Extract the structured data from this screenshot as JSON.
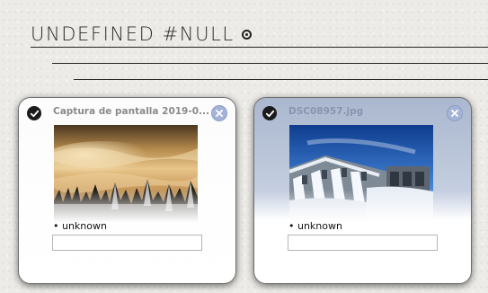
{
  "header": {
    "title": "UNDEFINED #NULL",
    "target_icon": "target-icon"
  },
  "cards": [
    {
      "filename": "Captura de pantalla 2019-0...",
      "tag": "• unknown",
      "tag_input_value": "",
      "selected": true,
      "thumbnail": "snowy-forest-sunset"
    },
    {
      "filename": "DSC08957.jpg",
      "tag": "• unknown",
      "tag_input_value": "",
      "selected": true,
      "thumbnail": "frozen-dam-waterfall"
    }
  ],
  "colors": {
    "background": "#ecebe7",
    "card_selected_tint": "#aab7ce",
    "close_button": "#a4b4d8",
    "text": "#2d2d2d"
  }
}
